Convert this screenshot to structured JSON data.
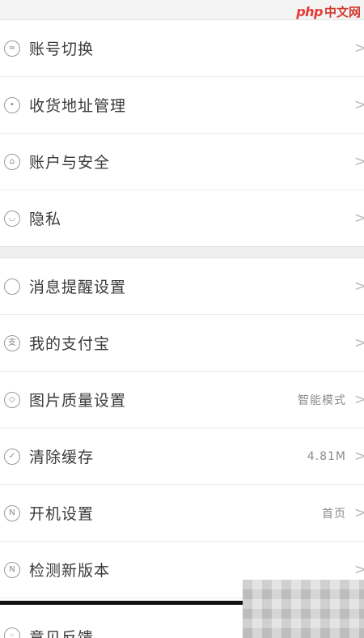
{
  "watermark": {
    "php": "php",
    "cn": "中文网"
  },
  "group1": [
    {
      "label": "账号切换",
      "icon": "switch-icon",
      "glyph": "≈",
      "value": ""
    },
    {
      "label": "收货地址管理",
      "icon": "location-pin-icon",
      "glyph": "•",
      "value": ""
    },
    {
      "label": "账户与安全",
      "icon": "lock-icon",
      "glyph": "⌂",
      "value": ""
    },
    {
      "label": "隐私",
      "icon": "privacy-icon",
      "glyph": "◡",
      "value": ""
    }
  ],
  "group2": [
    {
      "label": "消息提醒设置",
      "icon": "bell-icon",
      "glyph": "",
      "value": ""
    },
    {
      "label": "我的支付宝",
      "icon": "alipay-icon",
      "glyph": "支",
      "value": ""
    },
    {
      "label": "图片质量设置",
      "icon": "image-quality-icon",
      "glyph": "◇",
      "value": "智能模式"
    },
    {
      "label": "清除缓存",
      "icon": "clear-cache-icon",
      "glyph": "✓",
      "value": "4.81M"
    },
    {
      "label": "开机设置",
      "icon": "startup-icon",
      "glyph": "N",
      "value": "首页"
    },
    {
      "label": "检测新版本",
      "icon": "new-version-icon",
      "glyph": "N",
      "value": ""
    }
  ],
  "partial_row": {
    "label": "意见反馈",
    "icon": "feedback-icon",
    "glyph": "◦"
  },
  "chevron": ">"
}
